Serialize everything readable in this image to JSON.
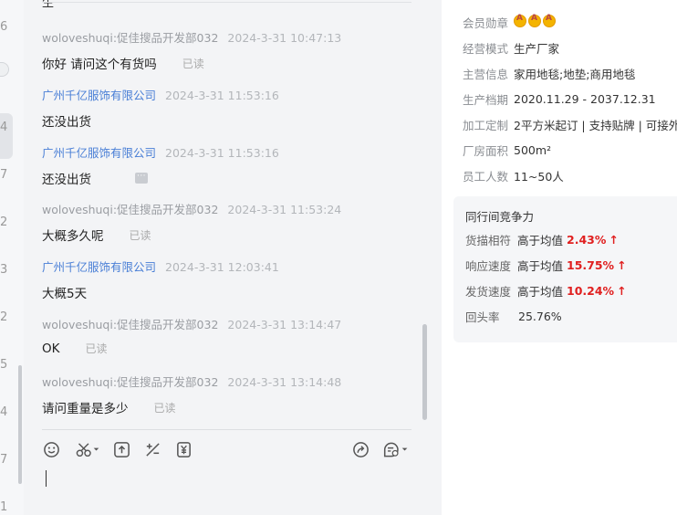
{
  "left_strip": {
    "numbers": [
      "6",
      "4",
      "7",
      "2",
      "3",
      "2",
      "5",
      "4",
      "7",
      "1"
    ]
  },
  "chat": {
    "top_fragment": "生",
    "messages": [
      {
        "sender": "woloveshuqi:促佳搜品开发部032",
        "time": "2024-3-31 10:47:13",
        "text": "你好  请问这个有货吗",
        "status": "已读",
        "is_company": false
      },
      {
        "sender": "广州千亿服饰有限公司",
        "time": "2024-3-31 11:53:16",
        "text": "还没出货",
        "status": "",
        "is_company": true
      },
      {
        "sender": "广州千亿服饰有限公司",
        "time": "2024-3-31 11:53:16",
        "text": "还没出货",
        "status": "",
        "is_company": true
      },
      {
        "sender": "woloveshuqi:促佳搜品开发部032",
        "time": "2024-3-31 11:53:24",
        "text": "大概多久呢",
        "status": "已读",
        "is_company": false
      },
      {
        "sender": "广州千亿服饰有限公司",
        "time": "2024-3-31 12:03:41",
        "text": "大概5天",
        "status": "",
        "is_company": true
      },
      {
        "sender": "woloveshuqi:促佳搜品开发部032",
        "time": "2024-3-31 13:14:47",
        "text": "OK",
        "status": "已读",
        "is_company": false
      },
      {
        "sender": "woloveshuqi:促佳搜品开发部032",
        "time": "2024-3-31 13:14:48",
        "text": "请问重量是多少",
        "status": "已读",
        "is_company": false
      }
    ],
    "toolbar_icons": [
      "emoji-icon",
      "scissors-icon",
      "upload-icon",
      "percent-icon",
      "price-icon",
      "forward-icon",
      "settings-icon"
    ]
  },
  "info": {
    "rows": [
      {
        "key": "会员勋章",
        "value": ""
      },
      {
        "key": "经营模式",
        "value": "生产厂家"
      },
      {
        "key": "主营信息",
        "value": "家用地毯;地垫;商用地毯"
      },
      {
        "key": "生产档期",
        "value": "2020.11.29 - 2037.12.31"
      },
      {
        "key": "加工定制",
        "value": "2平方米起订 | 支持贴牌 | 可接外贸"
      },
      {
        "key": "厂房面积",
        "value": "500m²"
      },
      {
        "key": "员工人数",
        "value": "11~50人"
      }
    ],
    "badges": 3,
    "competitiveness": {
      "title": "同行间竞争力",
      "rows": [
        {
          "key": "货描相符",
          "prefix": "高于均值",
          "pct": "2.43%",
          "arrow": "↑"
        },
        {
          "key": "响应速度",
          "prefix": "高于均值",
          "pct": "15.75%",
          "arrow": "↑"
        },
        {
          "key": "发货速度",
          "prefix": "高于均值",
          "pct": "10.24%",
          "arrow": "↑"
        },
        {
          "key": "回头率",
          "prefix": "",
          "pct": "",
          "arrow": "",
          "plain": "25.76%"
        }
      ]
    }
  },
  "colors": {
    "company_sender": "#4a7fd6",
    "highlight_red": "#e02020",
    "panel_bg": "#f3f4f6"
  }
}
